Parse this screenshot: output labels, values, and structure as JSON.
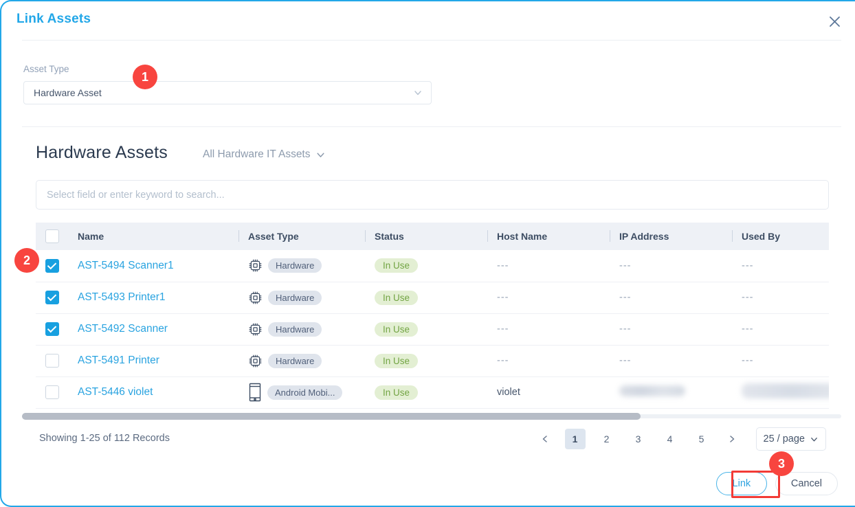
{
  "modal": {
    "title": "Link Assets",
    "close_icon": "close-icon"
  },
  "asset_type": {
    "label": "Asset Type",
    "value": "Hardware Asset",
    "caret_icon": "chevron-down-icon"
  },
  "section": {
    "title": "Hardware Assets",
    "filter_label": "All Hardware IT Assets",
    "filter_caret_icon": "chevron-down-icon"
  },
  "search": {
    "placeholder": "Select field or enter keyword to search...",
    "value": ""
  },
  "table": {
    "columns": [
      "Name",
      "Asset Type",
      "Status",
      "Host Name",
      "IP Address",
      "Used By"
    ],
    "rows": [
      {
        "checked": true,
        "name": "AST-5494 Scanner1",
        "type_icon": "cpu-chip-icon",
        "asset_type": "Hardware",
        "status": "In Use",
        "host_name": "---",
        "ip_address": "---",
        "used_by": "---"
      },
      {
        "checked": true,
        "name": "AST-5493 Printer1",
        "type_icon": "cpu-chip-icon",
        "asset_type": "Hardware",
        "status": "In Use",
        "host_name": "---",
        "ip_address": "---",
        "used_by": "---"
      },
      {
        "checked": true,
        "name": "AST-5492 Scanner",
        "type_icon": "cpu-chip-icon",
        "asset_type": "Hardware",
        "status": "In Use",
        "host_name": "---",
        "ip_address": "---",
        "used_by": "---"
      },
      {
        "checked": false,
        "name": "AST-5491 Printer",
        "type_icon": "cpu-chip-icon",
        "asset_type": "Hardware",
        "status": "In Use",
        "host_name": "---",
        "ip_address": "---",
        "used_by": "---"
      },
      {
        "checked": false,
        "name": "AST-5446 violet",
        "type_icon": "mobile-phone-icon",
        "asset_type": "Android Mobi...",
        "status": "In Use",
        "host_name": "violet",
        "ip_address": "",
        "used_by": ""
      }
    ]
  },
  "footer": {
    "records_text": "Showing 1-25 of 112 Records",
    "prev_icon": "chevron-left-icon",
    "next_icon": "chevron-right-icon",
    "pages": [
      "1",
      "2",
      "3",
      "4",
      "5"
    ],
    "active_page": "1",
    "page_size": "25 / page",
    "page_size_caret_icon": "chevron-down-icon"
  },
  "actions": {
    "link_label": "Link",
    "cancel_label": "Cancel"
  },
  "steps": {
    "one": "1",
    "two": "2",
    "three": "3"
  },
  "colors": {
    "accent": "#22a7e8",
    "link": "#29a3e0",
    "checkbox_checked": "#18a0e0",
    "status_text": "#72a443",
    "status_bg": "#e3efd3",
    "chip_bg": "#dfe4ec",
    "step_badge": "#f8453f",
    "highlight_box": "#f23b36",
    "header_bg": "#eef1f6"
  }
}
